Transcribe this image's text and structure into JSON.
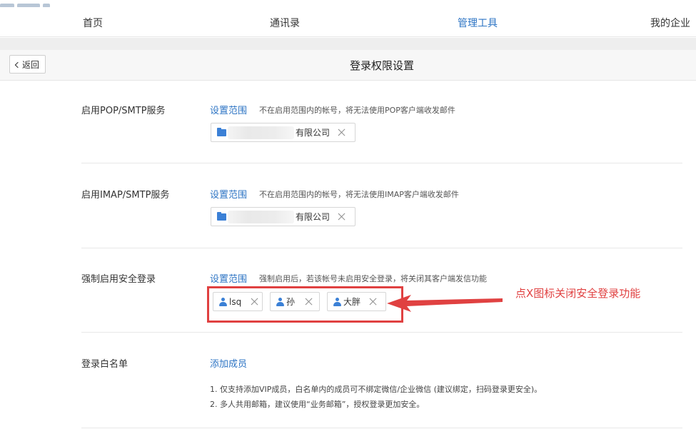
{
  "nav": {
    "items": [
      {
        "label": "首页"
      },
      {
        "label": "通讯录"
      },
      {
        "label": "管理工具"
      },
      {
        "label": "我的企业"
      }
    ]
  },
  "header": {
    "back_label": "返回",
    "title": "登录权限设置"
  },
  "sections": [
    {
      "label": "启用POP/SMTP服务",
      "link": "设置范围",
      "desc": "不在启用范围内的帐号，将无法使用POP客户端收发邮件",
      "tag": "有限公司"
    },
    {
      "label": "启用IMAP/SMTP服务",
      "link": "设置范围",
      "desc": "不在启用范围内的帐号，将无法使用IMAP客户端收发邮件",
      "tag": "有限公司"
    },
    {
      "label": "强制启用安全登录",
      "link": "设置范围",
      "desc": "强制启用后，若该帐号未启用安全登录，将关闭其客户端发信功能",
      "users": [
        {
          "name": "lsq"
        },
        {
          "name": "孙"
        },
        {
          "name": "大胖"
        }
      ]
    },
    {
      "label": "登录白名单",
      "link": "添加成员",
      "notes": [
        "1. 仅支持添加VIP成员，白名单内的成员可不绑定微信/企业微信 (建议绑定，扫码登录更安全)。",
        "2. 多人共用邮箱，建议使用“业务邮箱”，授权登录更加安全。"
      ]
    }
  ],
  "annotation": {
    "text": "点X图标关闭安全登录功能",
    "color": "#e04141"
  },
  "colors": {
    "link": "#2d74c4",
    "icon": "#3b80d6"
  }
}
